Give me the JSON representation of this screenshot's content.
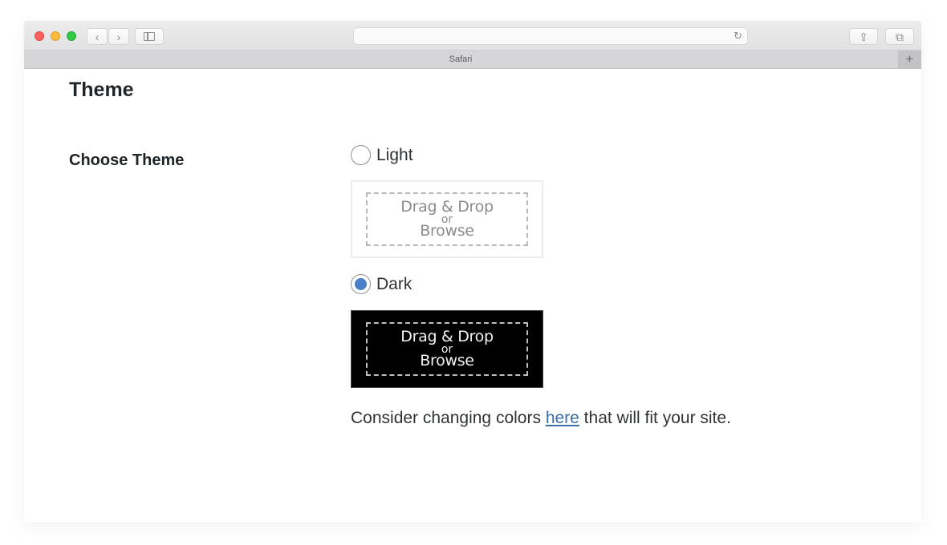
{
  "browser": {
    "app_name": "Safari",
    "tab_title": "Safari",
    "address_value": "",
    "icons": {
      "back": "chevron-left",
      "forward": "chevron-right",
      "sidebar": "sidebar",
      "reload": "reload",
      "share": "share",
      "tabs": "tab-overview",
      "new_tab": "plus"
    },
    "glyphs": {
      "back": "‹",
      "forward": "›",
      "reload": "↻",
      "share": "⇪",
      "tabs": "⧉",
      "new_tab": "+"
    }
  },
  "page": {
    "title": "Theme",
    "field_label": "Choose Theme",
    "options": [
      {
        "label": "Light",
        "selected": false,
        "preview": {
          "main": "Drag & Drop",
          "or": "or",
          "browse": "Browse"
        }
      },
      {
        "label": "Dark",
        "selected": true,
        "preview": {
          "main": "Drag & Drop",
          "or": "or",
          "browse": "Browse"
        }
      }
    ],
    "help": {
      "before": "Consider changing colors ",
      "link": "here",
      "after": " that will fit your site."
    },
    "colors": {
      "radio_selected": "#4a80c8",
      "link": "#3a6ea8",
      "dark_preview_bg": "#000000"
    }
  }
}
